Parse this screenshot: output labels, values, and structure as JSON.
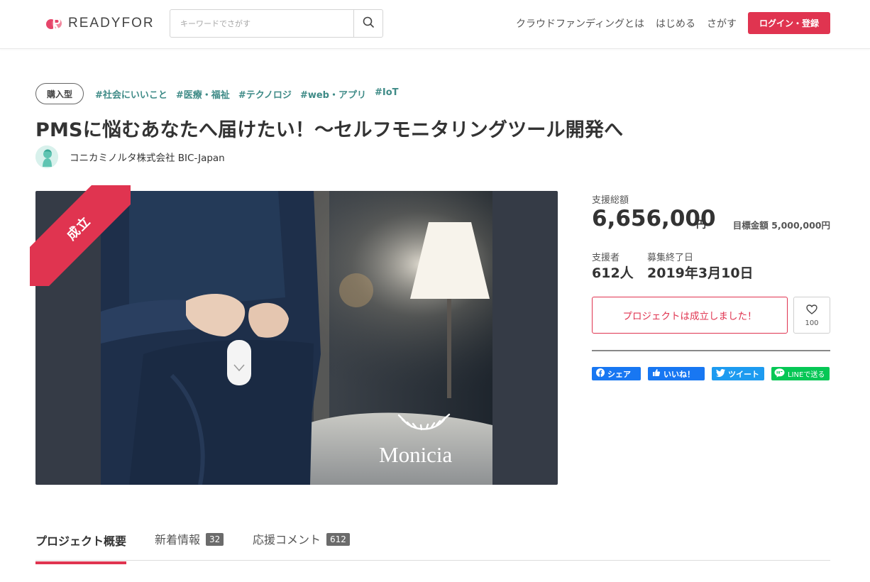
{
  "header": {
    "logo_text": "READYFOR",
    "search_placeholder": "キーワードでさがす",
    "nav": [
      "クラウドファンディングとは",
      "はじめる",
      "さがす"
    ],
    "login_label": "ログイン・登録"
  },
  "project": {
    "type_badge": "購入型",
    "tags": [
      "#社会にいいこと",
      "#医療・福祉",
      "#テクノロジ",
      "#web・アプリ",
      "#IoT"
    ],
    "title": "PMSに悩むあなたへ届けたい！〜セルフモニタリングツール開発へ",
    "owner": "コニカミノルタ株式会社 BIC-Japan",
    "ribbon": "成立",
    "image_brand": "Monicia"
  },
  "stats": {
    "total_label": "支援総額",
    "total_value": "6,656,000",
    "total_unit": "円",
    "goal": "目標金額 5,000,000円",
    "backers_label": "支援者",
    "backers_value": "612人",
    "end_label": "募集終了日",
    "end_value": "2019年3月10日"
  },
  "actions": {
    "success_label": "プロジェクトは成立しました！",
    "favorite_count": "100"
  },
  "social": {
    "facebook": "シェア",
    "like": "いいね！",
    "tweet": "ツイート",
    "line": "LINEで送る"
  },
  "tabs": [
    {
      "label": "プロジェクト概要"
    },
    {
      "label": "新着情報",
      "count": "32"
    },
    {
      "label": "応援コメント",
      "count": "612"
    }
  ],
  "colors": {
    "accent": "#e03450",
    "tag": "#3f8b87",
    "facebook": "#1877f2",
    "twitter": "#1d9bf0",
    "line": "#06c755"
  }
}
